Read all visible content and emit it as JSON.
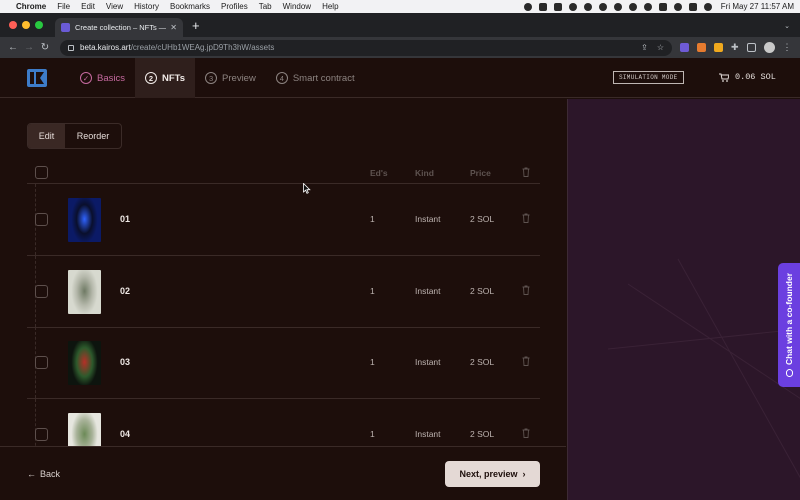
{
  "menubar": {
    "app": "Chrome",
    "items": [
      "File",
      "Edit",
      "View",
      "History",
      "Bookmarks",
      "Profiles",
      "Tab",
      "Window",
      "Help"
    ],
    "clock": "Fri May 27  11:57 AM"
  },
  "browser": {
    "tab_title": "Create collection – NFTs — Kai",
    "url_host": "beta.kairos.art",
    "url_path": "/create/cUHb1WEAg.jpD9Th3hW/assets"
  },
  "header": {
    "steps": [
      {
        "num": "1",
        "label": "Basics",
        "state": "done"
      },
      {
        "num": "2",
        "label": "NFTs",
        "state": "active"
      },
      {
        "num": "3",
        "label": "Preview",
        "state": "todo"
      },
      {
        "num": "4",
        "label": "Smart contract",
        "state": "todo"
      }
    ],
    "simulation_badge": "SIMULATION MODE",
    "cart_amount": "0.06 SOL"
  },
  "segmented": {
    "edit": "Edit",
    "reorder": "Reorder",
    "selected": "Edit"
  },
  "table": {
    "columns": {
      "editions": "Ed's",
      "kind": "Kind",
      "price": "Price"
    },
    "rows": [
      {
        "name": "01",
        "editions": "1",
        "kind": "Instant",
        "price": "2 SOL",
        "thumb_colors": [
          "#0b1a66",
          "#2f63ff",
          "#0a0f2c"
        ]
      },
      {
        "name": "02",
        "editions": "1",
        "kind": "Instant",
        "price": "2 SOL",
        "thumb_colors": [
          "#d7d9cf",
          "#6f7a64",
          "#b5b8ab"
        ]
      },
      {
        "name": "03",
        "editions": "1",
        "kind": "Instant",
        "price": "2 SOL",
        "thumb_colors": [
          "#0d140e",
          "#b52f27",
          "#2d5a2c"
        ]
      },
      {
        "name": "04",
        "editions": "1",
        "kind": "Instant",
        "price": "2 SOL",
        "thumb_colors": [
          "#e6e6df",
          "#6c8a57",
          "#a9b39a"
        ]
      }
    ]
  },
  "footer": {
    "back": "Back",
    "next": "Next, preview"
  },
  "chat": {
    "label": "Chat with a co-founder"
  },
  "colors": {
    "accent": "#c66aa0",
    "chat": "#6b3fe0",
    "background": "#1d0e0b"
  }
}
